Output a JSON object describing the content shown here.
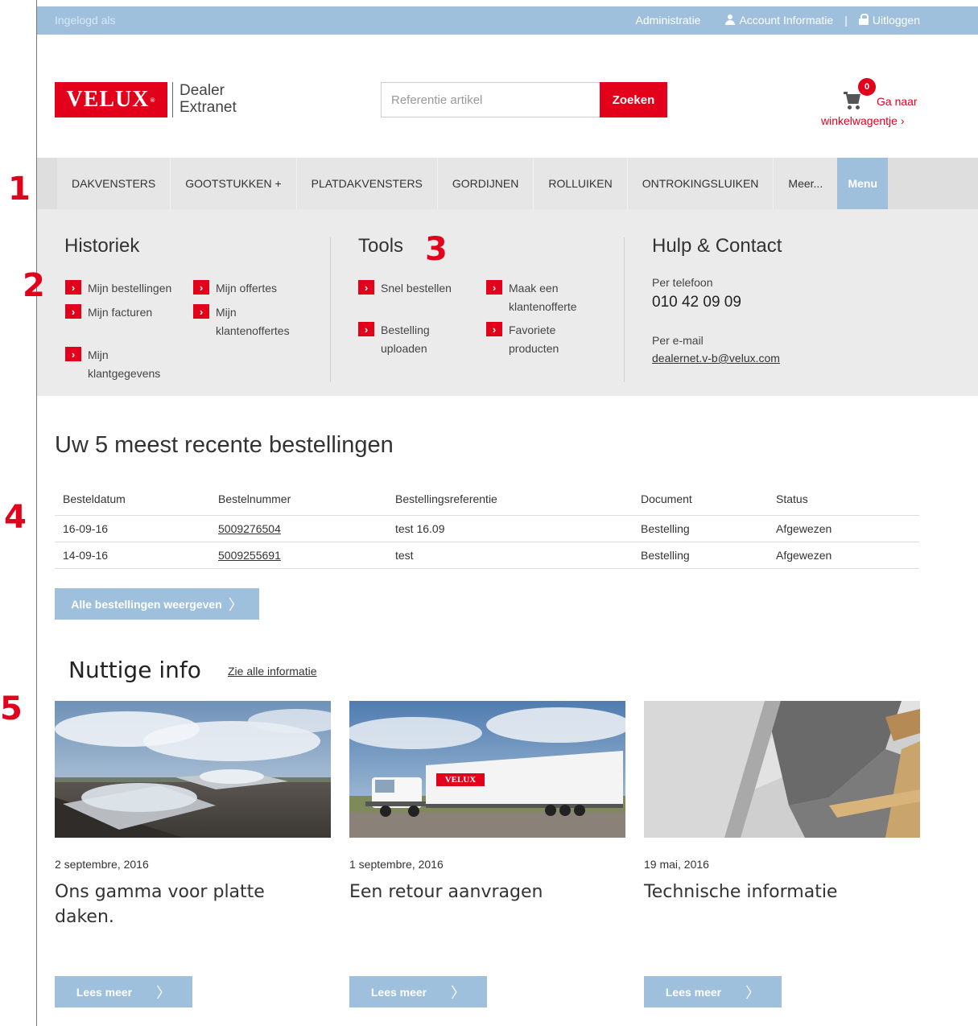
{
  "topbar": {
    "login_label": "Ingelogd als",
    "admin_link": "Administratie",
    "account_link": "Account Informatie",
    "separator": "|",
    "logout_link": "Uitloggen"
  },
  "header": {
    "logo_text": "VELUX",
    "logo_mark": "®",
    "logo_sub_line1": "Dealer",
    "logo_sub_line2": "Extranet",
    "search_placeholder": "Referentie artikel",
    "search_button": "Zoeken",
    "cart_count": "0",
    "cart_link_line1": "Ga naar",
    "cart_link_line2": "winkelwagentje ›"
  },
  "nav": {
    "items": [
      "DAKVENSTERS",
      "GOOTSTUKKEN +",
      "PLATDAKVENSTERS",
      "GORDIJNEN",
      "ROLLUIKEN",
      "ONTROKINGSLUIKEN",
      "Meer..."
    ],
    "menu_button": "Menu"
  },
  "mega_menu": {
    "historiek": {
      "title": "Historiek",
      "links": [
        "Mijn bestellingen",
        "Mijn offertes",
        "Mijn facturen",
        "Mijn klantenoffertes",
        "Mijn klantgegevens"
      ]
    },
    "tools": {
      "title": "Tools",
      "links": [
        "Snel bestellen",
        "Maak een klantenofferte",
        "Bestelling uploaden",
        "Favoriete producten"
      ]
    },
    "contact": {
      "title": "Hulp & Contact",
      "phone_label": "Per telefoon",
      "phone": "010 42 09 09",
      "email_label": "Per e-mail",
      "email": "dealernet.v-b@velux.com"
    },
    "chevron": "›"
  },
  "orders": {
    "title": "Uw 5 meest recente bestellingen",
    "columns": [
      "Besteldatum",
      "Bestelnummer",
      "Bestellingsreferentie",
      "Document",
      "Status"
    ],
    "rows": [
      [
        "16-09-16",
        "5009276504",
        "test 16.09",
        "Bestelling",
        "Afgewezen"
      ],
      [
        "14-09-16",
        "5009255691",
        "test",
        "Bestelling",
        "Afgewezen"
      ]
    ],
    "all_button": "Alle bestellingen weergeven",
    "arrow": "〉"
  },
  "info": {
    "title": "Nuttige info",
    "see_all": "Zie alle informatie",
    "cards": [
      {
        "date": "2 septembre, 2016",
        "title": "Ons gamma voor platte daken.",
        "button": "Lees meer"
      },
      {
        "date": "1 septembre, 2016",
        "title": "Een retour aanvragen",
        "button": "Lees meer"
      },
      {
        "date": "19 mai, 2016",
        "title": "Technische informatie",
        "button": "Lees meer"
      }
    ],
    "truck_logo": "VELUX"
  },
  "annotations": [
    "1",
    "2",
    "3",
    "4",
    "5"
  ],
  "colors": {
    "brand_red": "#e3001b",
    "accent_blue": "#9ec0dd",
    "nav_gray": "#dedede",
    "menu_gray": "#ebebeb"
  },
  "icons": {
    "account": "user-icon",
    "logout": "lock-icon",
    "cart": "cart-icon",
    "link_bullet": "chevron-right-icon"
  }
}
